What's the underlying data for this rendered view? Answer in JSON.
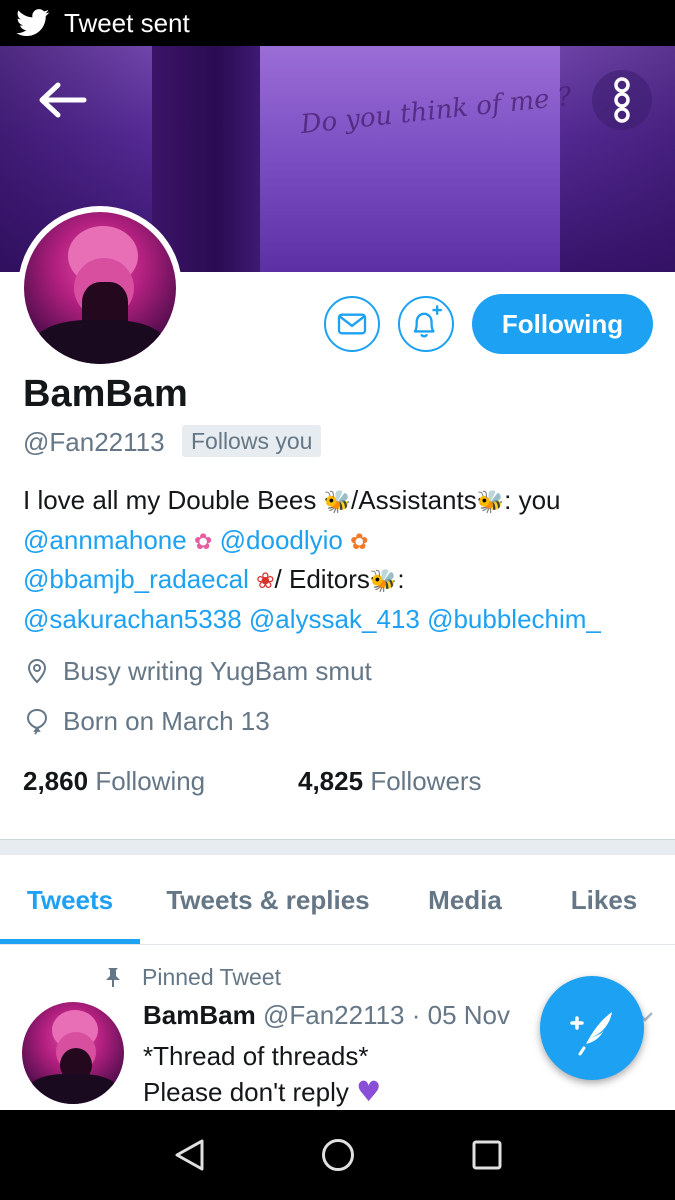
{
  "status_bar": {
    "notification_text": "Tweet sent"
  },
  "banner": {
    "wall_writing": "Do you think of me ?"
  },
  "profile": {
    "name": "BamBam",
    "handle": "@Fan22113",
    "follows_you": "Follows you",
    "follow_button_label": "Following",
    "bio": {
      "line1_text_a": "I love all my Double Bees ",
      "line1_text_b": "/Assistants",
      "line1_text_c": ": you",
      "mention1": "@annmahone",
      "mention2": "@doodlyio",
      "mention3": "@bbamjb_radaecal",
      "line3_text": "/ Editors",
      "line3_colon": ":",
      "mention4": "@sakurachan5338",
      "mention5": "@alyssak_413",
      "mention6": "@bubblechim_"
    },
    "location": "Busy writing YugBam smut",
    "birthday": "Born on March 13",
    "following_count": "2,860",
    "following_label": "Following",
    "followers_count": "4,825",
    "followers_label": "Followers"
  },
  "tabs": [
    {
      "label": "Tweets",
      "active": true
    },
    {
      "label": "Tweets & replies",
      "active": false
    },
    {
      "label": "Media",
      "active": false
    },
    {
      "label": "Likes",
      "active": false
    }
  ],
  "pinned_tweet": {
    "pinned_label": "Pinned Tweet",
    "author_name": "BamBam",
    "author_handle_date": "@Fan22113 · 05 Nov",
    "text_line1": "*Thread of threads*",
    "text_line2": "Please don't reply"
  },
  "icons": {
    "twitter": "twitter-bird-icon",
    "back": "back-arrow-icon",
    "more": "more-vertical-icon",
    "message": "envelope-icon",
    "notifications": "bell-plus-icon",
    "location": "location-pin-icon",
    "birthday": "balloon-icon",
    "pin": "pin-icon",
    "compose": "compose-tweet-icon",
    "nav_back": "nav-back-icon",
    "nav_home": "nav-home-icon",
    "nav_recents": "nav-recents-icon"
  },
  "colors": {
    "accent": "#1da1f2",
    "text_primary": "#14171a",
    "text_secondary": "#657786",
    "banner_purple": "#6a3aae"
  }
}
